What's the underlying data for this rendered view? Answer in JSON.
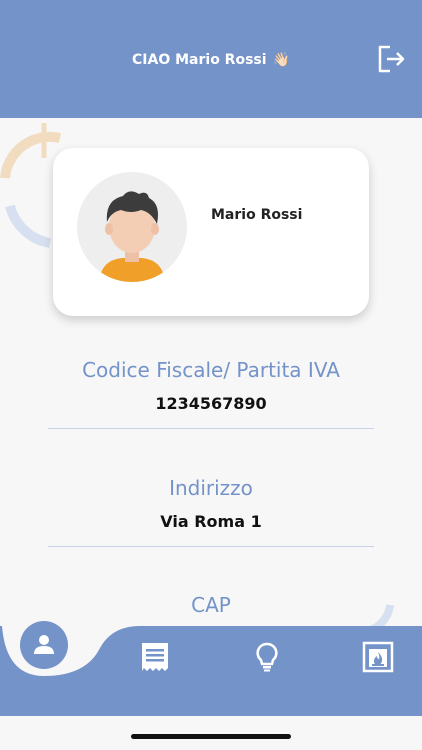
{
  "header": {
    "greeting": "CIAO Mario Rossi",
    "wave_emoji": "👋🏻",
    "logout_icon": "logout-icon"
  },
  "profile_card": {
    "name": "Mario Rossi",
    "avatar_icon": "avatar-icon"
  },
  "fields": [
    {
      "label": "Codice Fiscale/ Partita IVA",
      "value": "1234567890"
    },
    {
      "label": "Indirizzo",
      "value": "Via Roma 1"
    },
    {
      "label": "CAP",
      "value": ""
    }
  ],
  "bottom_nav": {
    "items": [
      {
        "icon": "user-icon",
        "active": true
      },
      {
        "icon": "receipt-icon",
        "active": false
      },
      {
        "icon": "lightbulb-icon",
        "active": false
      },
      {
        "icon": "fireplace-icon",
        "active": false
      }
    ]
  },
  "colors": {
    "accent": "#7393c9",
    "background": "#f7f7f7",
    "card": "#ffffff"
  }
}
